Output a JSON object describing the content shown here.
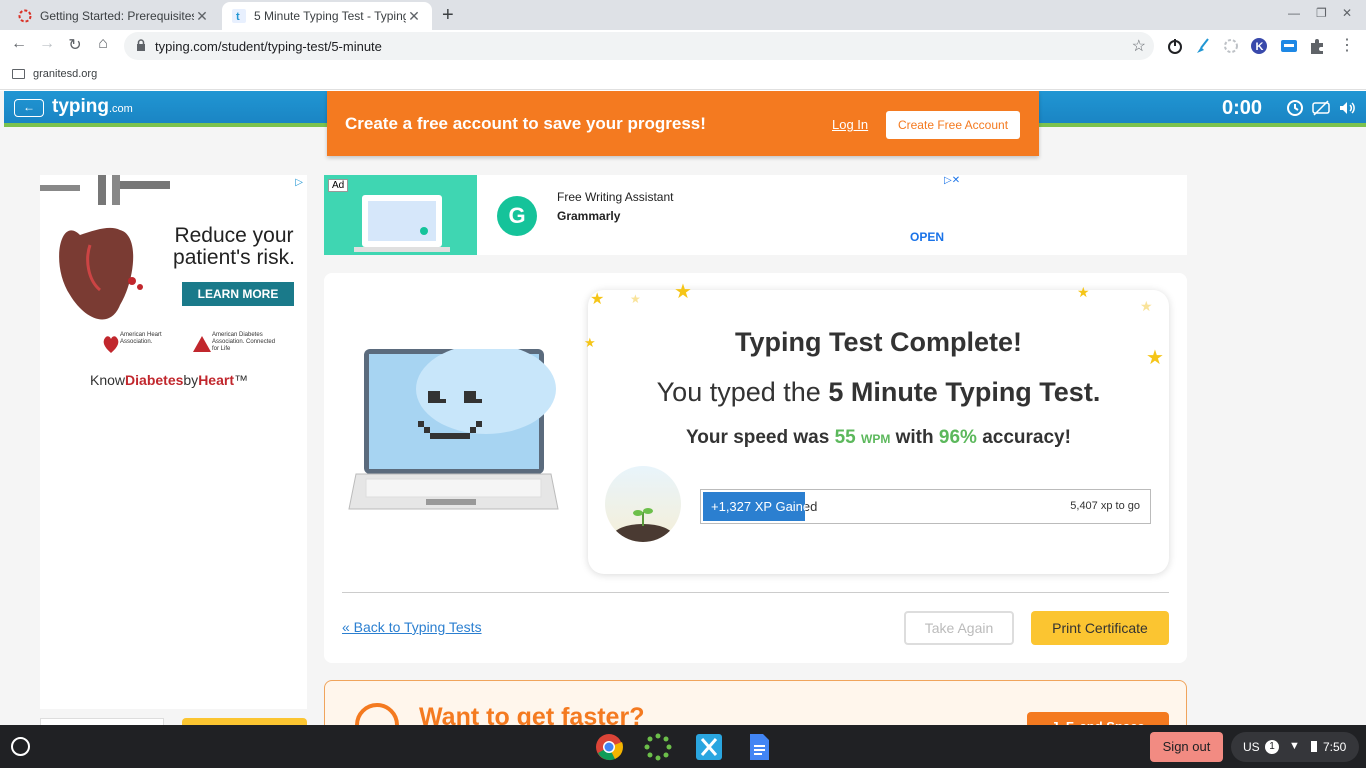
{
  "browser": {
    "tabs": [
      {
        "title": "Getting Started: Prerequisites",
        "active": false
      },
      {
        "title": "5 Minute Typing Test - Typing.com",
        "active": true
      }
    ],
    "url": "typing.com/student/typing-test/5-minute",
    "bookmark": "granitesd.org"
  },
  "site": {
    "logo": "typing",
    "logo_suffix": ".com",
    "timer": "0:00",
    "promo_message": "Create a free account to save your progress!",
    "login_label": "Log In",
    "create_label": "Create Free Account"
  },
  "left_ad": {
    "headline": "Reduce your patient's risk.",
    "cta": "LEARN MORE",
    "org1": "American Heart Association.",
    "org2": "American Diabetes Association. Connected for Life",
    "brand_pre": "Know",
    "brand_mid": "Diabetes",
    "brand_by": "by",
    "brand_end": "Heart",
    "brand_tm": "™"
  },
  "top_ad": {
    "label": "Ad",
    "line1": "Free Writing Assistant",
    "line2": "Grammarly",
    "open": "OPEN",
    "logo_letter": "G"
  },
  "result": {
    "title": "Typing Test Complete!",
    "typed_prefix": "You typed the ",
    "test_name": "5 Minute Typing Test",
    "typed_suffix": ".",
    "speed_prefix": "Your speed was ",
    "speed": "55",
    "speed_unit": "WPM",
    "accuracy_prefix": " with ",
    "accuracy": "96%",
    "accuracy_suffix": " accuracy!",
    "xp_gained": "+1,327 XP Gained",
    "xp_progress": 0.23,
    "xp_to_go": "5,407 xp to go"
  },
  "actions": {
    "back": "« Back to Typing Tests",
    "take_again": "Take Again",
    "print": "Print Certificate"
  },
  "faster": {
    "text": "Want to get faster?",
    "button": "J, F, and Space"
  },
  "shelf": {
    "sign_out": "Sign out",
    "ime": "US",
    "notifications": "1",
    "time": "7:50"
  },
  "colors": {
    "orange": "#f47a20",
    "blue": "#2196d3",
    "green": "#5cb85c",
    "yellow": "#fbc531"
  }
}
